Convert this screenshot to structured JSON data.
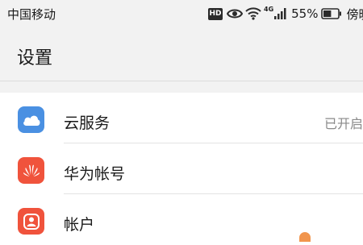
{
  "status_bar": {
    "carrier": "中国移动",
    "hd_badge": "HD",
    "network_label": "4G",
    "battery_percent": "55%",
    "clock": "傍晚",
    "battery_level": 0.55,
    "icons": [
      "hd-icon",
      "eye-icon",
      "wifi-icon",
      "signal-icon",
      "battery-icon"
    ]
  },
  "header": {
    "title": "设置"
  },
  "settings": {
    "items": [
      {
        "label": "云服务",
        "value": "已开启",
        "icon": "cloud-icon",
        "icon_color": "#4a90e2"
      },
      {
        "label": "华为帐号",
        "value": "",
        "icon": "huawei-logo-icon",
        "icon_color": "#f0533c"
      },
      {
        "label": "帐户",
        "value": "",
        "icon": "account-icon",
        "icon_color": "#f0533c"
      }
    ]
  },
  "colors": {
    "background": "#f2f2f2",
    "cloud_blue": "#4a90e2",
    "huawei_red": "#f0533c",
    "accent_orange": "#f08a3a"
  }
}
